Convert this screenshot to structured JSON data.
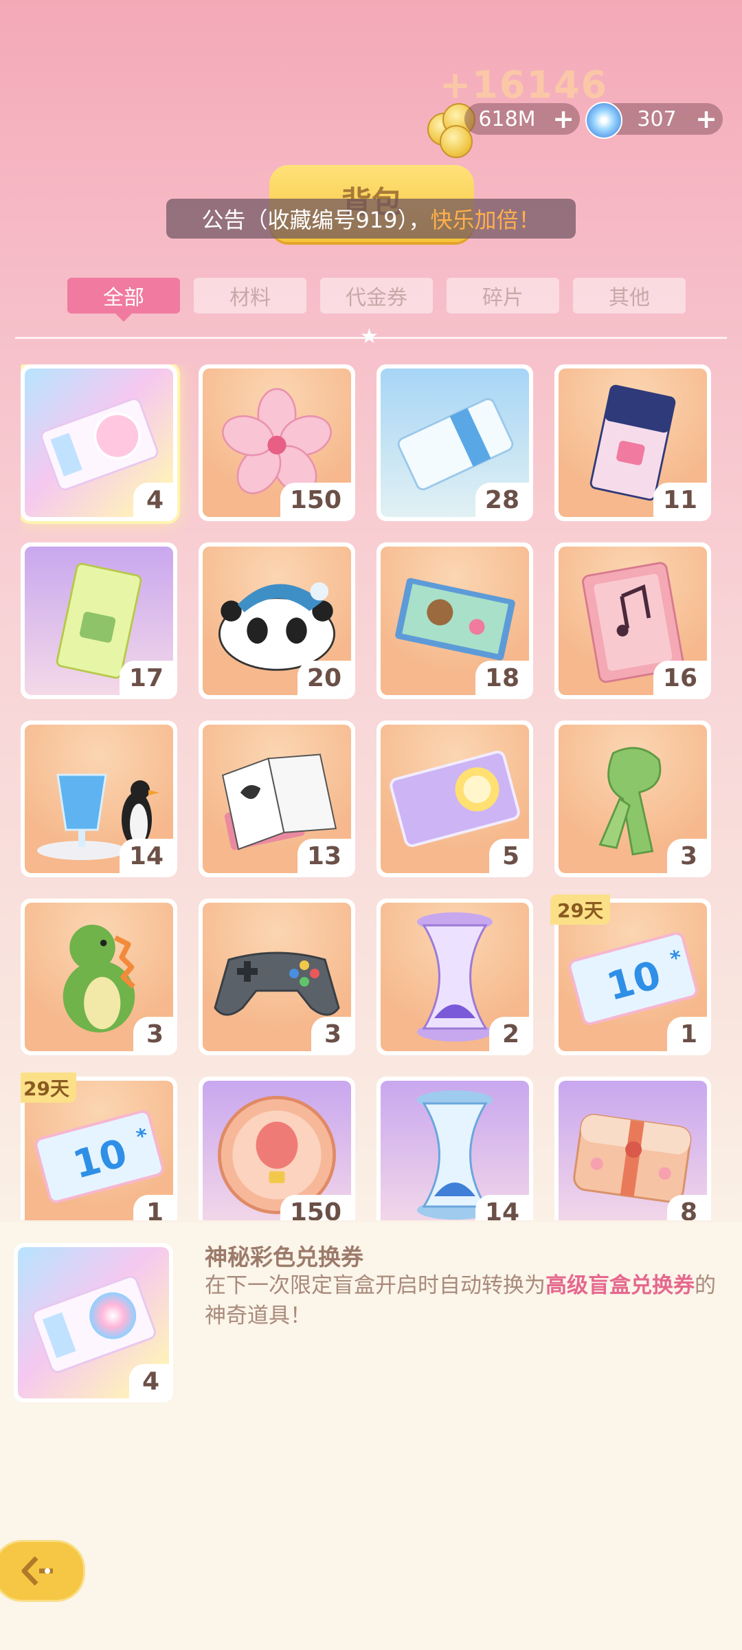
{
  "currency": {
    "gain_text": "+16146",
    "gold_value": "618M",
    "gem_value": "307",
    "coin_icon": "coin-stack-icon",
    "gem_icon": "snowflake-gem-icon"
  },
  "header": {
    "title": "背包",
    "announcement_prefix": "公告（收藏编号919），",
    "announcement_highlight": "快乐加倍！"
  },
  "tabs": [
    {
      "label": "全部",
      "active": true
    },
    {
      "label": "材料",
      "active": false
    },
    {
      "label": "代金券",
      "active": false
    },
    {
      "label": "碎片",
      "active": false
    },
    {
      "label": "其他",
      "active": false
    }
  ],
  "items": [
    {
      "icon": "rainbow-ticket-icon",
      "count": "4",
      "bg": "rainbow",
      "selected": true
    },
    {
      "icon": "sakura-flower-icon",
      "count": "150",
      "bg": "orange"
    },
    {
      "icon": "blue-ticket-icon",
      "count": "28",
      "bg": "blue"
    },
    {
      "icon": "navy-ticket-icon",
      "count": "11",
      "bg": "orange"
    },
    {
      "icon": "green-ticket-icon",
      "count": "17",
      "bg": "purple"
    },
    {
      "icon": "panda-plush-icon",
      "count": "20",
      "bg": "orange"
    },
    {
      "icon": "puzzle-box-icon",
      "count": "18",
      "bg": "orange"
    },
    {
      "icon": "music-book-icon",
      "count": "16",
      "bg": "orange"
    },
    {
      "icon": "blue-drink-penguin-icon",
      "count": "14",
      "bg": "orange"
    },
    {
      "icon": "manga-book-icon",
      "count": "13",
      "bg": "orange"
    },
    {
      "icon": "purple-card-icon",
      "count": "5",
      "bg": "orange"
    },
    {
      "icon": "green-scarf-icon",
      "count": "3",
      "bg": "orange"
    },
    {
      "icon": "dinosaur-plush-icon",
      "count": "3",
      "bg": "orange"
    },
    {
      "icon": "gamepad-icon",
      "count": "3",
      "bg": "orange"
    },
    {
      "icon": "purple-hourglass-icon",
      "count": "2",
      "bg": "orange"
    },
    {
      "icon": "sale-10-coupon-icon",
      "count": "1",
      "bg": "orange",
      "days": "29天"
    },
    {
      "icon": "sale-10-coupon-icon",
      "count": "1",
      "bg": "orange",
      "days": "29天"
    },
    {
      "icon": "balloon-medal-icon",
      "count": "150",
      "bg": "purple"
    },
    {
      "icon": "blue-hourglass-icon",
      "count": "14",
      "bg": "purple"
    },
    {
      "icon": "bento-box-icon",
      "count": "8",
      "bg": "purple"
    }
  ],
  "detail": {
    "icon": "rainbow-ticket-icon",
    "count": "4",
    "name": "神秘彩色兑换券",
    "desc_prefix": "在下一次限定盲盒开启时自动转换为",
    "desc_highlight": "高级盲盒兑换券",
    "desc_suffix": "的神奇道具！"
  },
  "back_button_icon": "back-arrow-icon",
  "colors": {
    "accent_pink": "#f07aa0",
    "highlight_orange": "#ffb04a",
    "desc_pink": "#e5688e",
    "gold": "#f6c744"
  }
}
